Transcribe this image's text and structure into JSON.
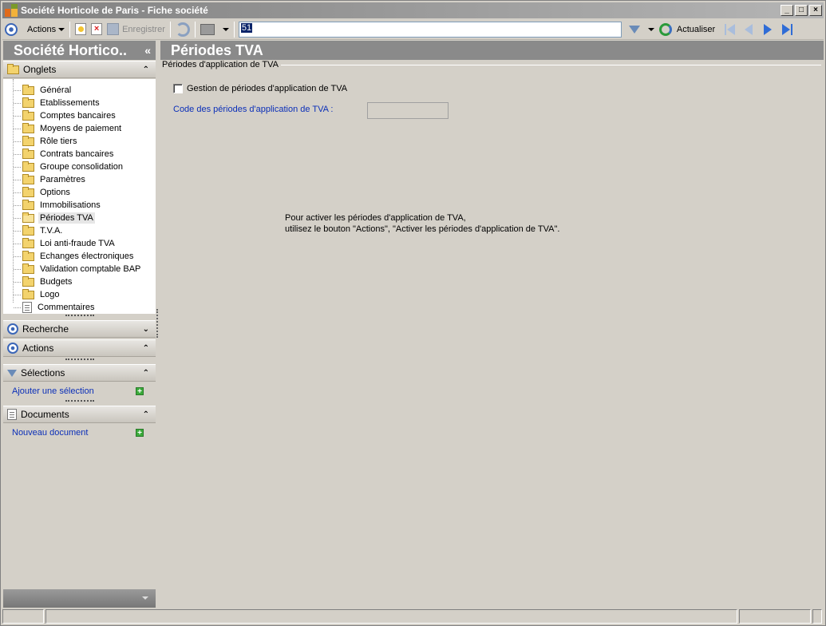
{
  "window": {
    "title": "Société Horticole de Paris -  Fiche société",
    "controls": [
      "minimize",
      "maximize",
      "close"
    ]
  },
  "toolbar": {
    "actions_label": "Actions",
    "save_label": "Enregistrer",
    "search_value": "51",
    "refresh_label": "Actualiser"
  },
  "sidebar": {
    "title": "Société Hortico..",
    "collapse_glyph": "«",
    "onglets_label": "Onglets",
    "tree_items": [
      {
        "label": "Général",
        "icon": "folder-icon"
      },
      {
        "label": "Etablissements",
        "icon": "folder-icon"
      },
      {
        "label": "Comptes bancaires",
        "icon": "folder-icon"
      },
      {
        "label": "Moyens de paiement",
        "icon": "folder-icon"
      },
      {
        "label": "Rôle tiers",
        "icon": "folder-icon"
      },
      {
        "label": "Contrats bancaires",
        "icon": "folder-icon"
      },
      {
        "label": "Groupe consolidation",
        "icon": "folder-icon"
      },
      {
        "label": "Paramètres",
        "icon": "folder-icon"
      },
      {
        "label": "Options",
        "icon": "folder-icon"
      },
      {
        "label": "Immobilisations",
        "icon": "folder-icon"
      },
      {
        "label": "Périodes TVA",
        "icon": "folder-open-icon",
        "selected": true
      },
      {
        "label": "T.V.A.",
        "icon": "folder-icon"
      },
      {
        "label": "Loi anti-fraude TVA",
        "icon": "folder-icon"
      },
      {
        "label": "Echanges électroniques",
        "icon": "folder-icon"
      },
      {
        "label": "Validation comptable BAP",
        "icon": "folder-icon"
      },
      {
        "label": "Budgets",
        "icon": "folder-icon"
      },
      {
        "label": "Logo",
        "icon": "folder-icon"
      },
      {
        "label": "Commentaires",
        "icon": "document-icon"
      }
    ],
    "recherche_label": "Recherche",
    "actions_label": "Actions",
    "selections_label": "Sélections",
    "add_selection_label": "Ajouter une sélection",
    "documents_label": "Documents",
    "new_document_label": "Nouveau document"
  },
  "main": {
    "title": "Périodes TVA",
    "group_label": "Périodes d'application de TVA",
    "checkbox_label": "Gestion de périodes d'application de TVA",
    "checkbox_checked": false,
    "code_label": "Code des périodes d'application de TVA :",
    "code_value": "",
    "hint_line1": "Pour activer les périodes d'application de TVA,",
    "hint_line2": "utilisez le bouton \"Actions\", \"Activer les périodes d'application de TVA\"."
  },
  "colors": {
    "header_gray": "#8a8a8a",
    "link_blue": "#0b2fb8",
    "background": "#d4d0c8"
  }
}
